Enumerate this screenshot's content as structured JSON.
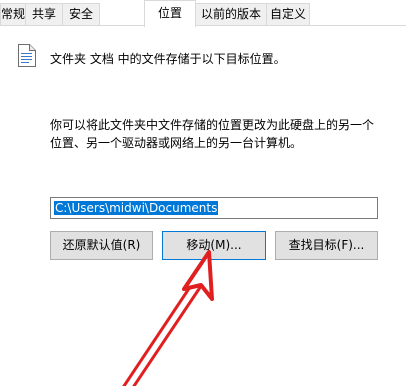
{
  "tabs": [
    {
      "label": "常规",
      "active": false
    },
    {
      "label": "共享",
      "active": false
    },
    {
      "label": "安全",
      "active": false
    },
    {
      "label": "位置",
      "active": true
    },
    {
      "label": "以前的版本",
      "active": false
    },
    {
      "label": "自定义",
      "active": false
    }
  ],
  "location": {
    "info_text": "文件夹 文档 中的文件存储于以下目标位置。",
    "description_line1": "你可以将此文件夹中文件存储的位置更改为此硬盘上的另一个",
    "description_line2": "位置、另一个驱动器或网络上的另一台计算机。",
    "path_value": "C:\\Users\\midwi\\Documents"
  },
  "buttons": {
    "restore_default": "还原默认值(R)",
    "move": "移动(M)...",
    "find_target": "查找目标(F)..."
  },
  "annotation": {
    "arrow_color": "#e02020",
    "points_to": "move"
  },
  "icons": {
    "document": "document-icon"
  }
}
